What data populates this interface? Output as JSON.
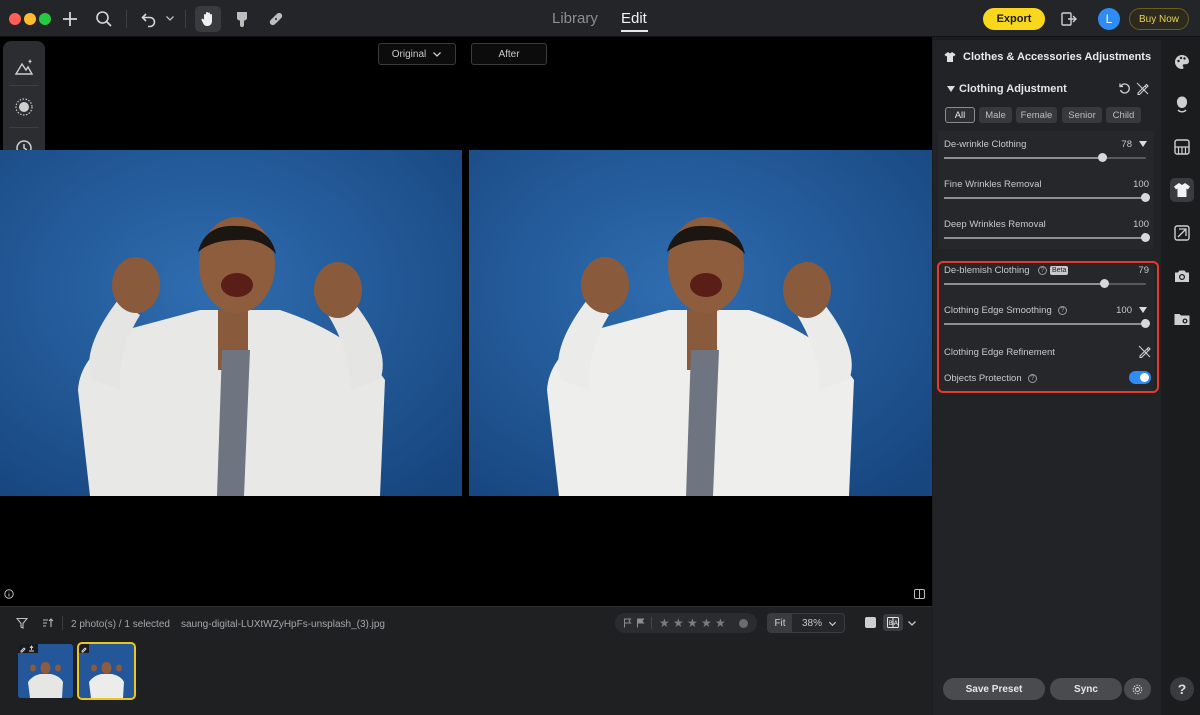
{
  "window": {
    "mode_tabs": [
      {
        "label": "Library"
      },
      {
        "label": "Edit"
      }
    ],
    "export_label": "Export",
    "avatar_initial": "L",
    "buy_label": "Buy Now",
    "accent_yellow": "#f9d71c",
    "accent_blue": "#2f8cf5"
  },
  "canvas": {
    "original_label": "Original",
    "after_label": "After"
  },
  "filmstrip": {
    "count_text": "2 photo(s) / 1 selected",
    "filename": "saung-digital-LUXtWZyHpFs-unsplash_(3).jpg",
    "fit_label": "Fit",
    "zoom_label": "38%",
    "stars": [
      "★",
      "★",
      "★",
      "★",
      "★"
    ],
    "thumb_count": 2,
    "selected_thumb": 2
  },
  "panel": {
    "title": "Clothes & Accessories Adjustments",
    "section_title": "Clothing Adjustment",
    "chips": [
      {
        "label": "All",
        "active": true
      },
      {
        "label": "Male",
        "active": false
      },
      {
        "label": "Female",
        "active": false
      },
      {
        "label": "Senior",
        "active": false
      },
      {
        "label": "Child",
        "active": false
      }
    ],
    "wrinkle": {
      "label": "De-wrinkle Clothing",
      "value": "78",
      "fine_label": "Fine Wrinkles Removal",
      "fine_value": "100",
      "deep_label": "Deep Wrinkles Removal",
      "deep_value": "100"
    },
    "blemish": {
      "label": "De-blemish Clothing",
      "badge": "Beta",
      "value": "79",
      "edge_smooth_label": "Clothing Edge Smoothing",
      "edge_smooth_value": "100",
      "edge_refine_label": "Clothing Edge Refinement",
      "objects_label": "Objects Protection",
      "objects_on": true
    },
    "save_preset_label": "Save Preset",
    "sync_label": "Sync"
  },
  "rail": {
    "help_label": "?"
  }
}
